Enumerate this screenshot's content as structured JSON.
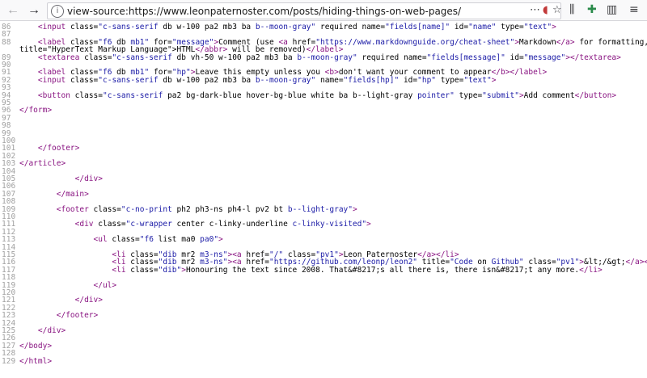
{
  "browser": {
    "url": "view-source:https://www.leonpaternoster.com/posts/hiding-things-on-web-pages/",
    "icons": [
      "back-arrow-icon",
      "forward-arrow-icon",
      "info-icon",
      "page-actions-icon",
      "pocket-icon",
      "bookmark-star-icon",
      "library-icon",
      "sidebar-icon",
      "extension-icon",
      "menu-icon"
    ]
  },
  "source": {
    "lines": [
      {
        "n": "86",
        "html": "    &lt;input class=\"c-sans-serif db w-100 pa2 mb3 ba b--moon-gray\" required name=\"fields[name]\" id=\"name\" type=\"text\"&gt;"
      },
      {
        "n": "87",
        "html": ""
      },
      {
        "n": "88",
        "html": "    &lt;label class=\"f6 db mb1\" for=\"message\"&gt;Comment (use &lt;a href=\"https://www.markdownguide.org/cheat-sheet\"&gt;Markdown&lt;/a&gt; for formatting, &lt;abbr"
      },
      {
        "n": "",
        "html": "title=\"HyperText Markup Language\"&gt;HTML&lt;/abbr&gt; will be removed)&lt;/label&gt;"
      },
      {
        "n": "89",
        "html": "    &lt;textarea class=\"c-sans-serif db vh-50 w-100 pa2 mb3 ba b--moon-gray\" required name=\"fields[message]\" id=\"message\"&gt;&lt;/textarea&gt;"
      },
      {
        "n": "90",
        "html": ""
      },
      {
        "n": "91",
        "html": "    &lt;label class=\"f6 db mb1\" for=\"hp\"&gt;Leave this empty unless you &lt;b&gt;don't want your comment to appear&lt;/b&gt;&lt;/label&gt;"
      },
      {
        "n": "92",
        "html": "    &lt;input class=\"c-sans-serif db w-100 pa2 mb3 ba b--moon-gray\" name=\"fields[hp]\" id=\"hp\" type=\"text\"&gt;"
      },
      {
        "n": "93",
        "html": ""
      },
      {
        "n": "94",
        "html": "    &lt;button class=\"c-sans-serif pa2 bg-dark-blue hover-bg-blue white ba b--light-gray pointer\" type=\"submit\"&gt;Add comment&lt;/button&gt;"
      },
      {
        "n": "95",
        "html": ""
      },
      {
        "n": "96",
        "html": "&lt;/form&gt;"
      },
      {
        "n": "97",
        "html": ""
      },
      {
        "n": "98",
        "html": ""
      },
      {
        "n": "99",
        "html": ""
      },
      {
        "n": "100",
        "html": ""
      },
      {
        "n": "101",
        "html": "    &lt;/footer&gt;"
      },
      {
        "n": "102",
        "html": ""
      },
      {
        "n": "103",
        "html": "&lt;/article&gt;"
      },
      {
        "n": "104",
        "html": ""
      },
      {
        "n": "105",
        "html": "            &lt;/div&gt;"
      },
      {
        "n": "106",
        "html": ""
      },
      {
        "n": "107",
        "html": "        &lt;/main&gt;"
      },
      {
        "n": "108",
        "html": ""
      },
      {
        "n": "109",
        "html": "        &lt;footer class=\"c-no-print ph2 ph3-ns ph4-l pv2 bt b--light-gray\"&gt;"
      },
      {
        "n": "110",
        "html": ""
      },
      {
        "n": "111",
        "html": "            &lt;div class=\"c-wrapper center c-linky-underline c-linky-visited\"&gt;"
      },
      {
        "n": "112",
        "html": ""
      },
      {
        "n": "113",
        "html": "                &lt;ul class=\"f6 list ma0 pa0\"&gt;"
      },
      {
        "n": "114",
        "html": ""
      },
      {
        "n": "115",
        "html": "                    &lt;li class=\"dib mr2 m3-ns\"&gt;&lt;a href=\"/\" class=\"pv1\"&gt;Leon Paternoster&lt;/a&gt;&lt;/li&gt;"
      },
      {
        "n": "116",
        "html": "                    &lt;li class=\"dib mr2 m3-ns\"&gt;&lt;a href=\"https://github.com/leonp/leon2\" title=\"Code on Github\" class=\"pv1\"&gt;&amp;lt;/&amp;gt;&lt;/a&gt;&lt;/li&gt;"
      },
      {
        "n": "117",
        "html": "                    &lt;li class=\"dib\"&gt;Honouring the text since 2008. That&amp;#8217;s all there is, there isn&amp;#8217;t any more.&lt;/li&gt;"
      },
      {
        "n": "118",
        "html": ""
      },
      {
        "n": "119",
        "html": "                &lt;/ul&gt;"
      },
      {
        "n": "120",
        "html": ""
      },
      {
        "n": "121",
        "html": "            &lt;/div&gt;"
      },
      {
        "n": "122",
        "html": ""
      },
      {
        "n": "123",
        "html": "        &lt;/footer&gt;"
      },
      {
        "n": "124",
        "html": ""
      },
      {
        "n": "125",
        "html": "    &lt;/div&gt;"
      },
      {
        "n": "126",
        "html": ""
      },
      {
        "n": "127",
        "html": "&lt;/body&gt;"
      },
      {
        "n": "128",
        "html": ""
      },
      {
        "n": "129",
        "html": "&lt;/html&gt;"
      }
    ]
  },
  "colors": {
    "tag": "#881280",
    "tag_end_mismatch": "#cc0000",
    "attr_value": "#1a1aa6",
    "line_number": "#a0a0a0"
  }
}
